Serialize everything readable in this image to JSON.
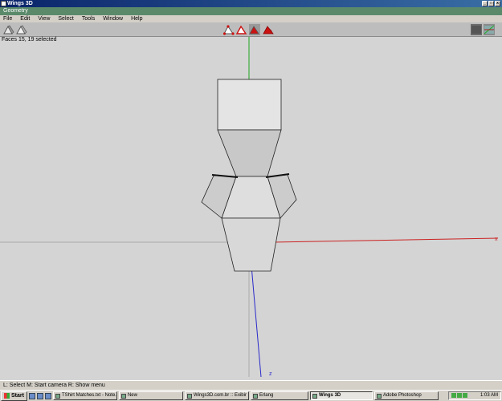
{
  "window": {
    "title": "Wings 3D",
    "caption_buttons": [
      "_",
      "□",
      "x"
    ]
  },
  "geometry_title": "Geometry",
  "menu": [
    "File",
    "Edit",
    "View",
    "Select",
    "Tools",
    "Window",
    "Help"
  ],
  "status": "Faces 15, 19 selected",
  "axis_label_z": "z",
  "axis_label_x": "x",
  "helpbar": "L: Select   M: Start camera   R: Show menu",
  "taskbar": {
    "start": "Start",
    "tasks": [
      {
        "label": "TShirt Matches.txt - Note..."
      },
      {
        "label": "New"
      },
      {
        "label": "Wings3D.com.br :: Exibir ..."
      },
      {
        "label": "Erlang"
      },
      {
        "label": "Wings 3D"
      },
      {
        "label": "Adobe Photoshop"
      }
    ],
    "clock": "1:03 AM"
  },
  "colors": {
    "accent_red": "#cc1111",
    "axis_green": "#1ea41e",
    "axis_red": "#cc2222",
    "axis_blue": "#2a2acc",
    "viewport_bg": "#d4d4d4"
  }
}
